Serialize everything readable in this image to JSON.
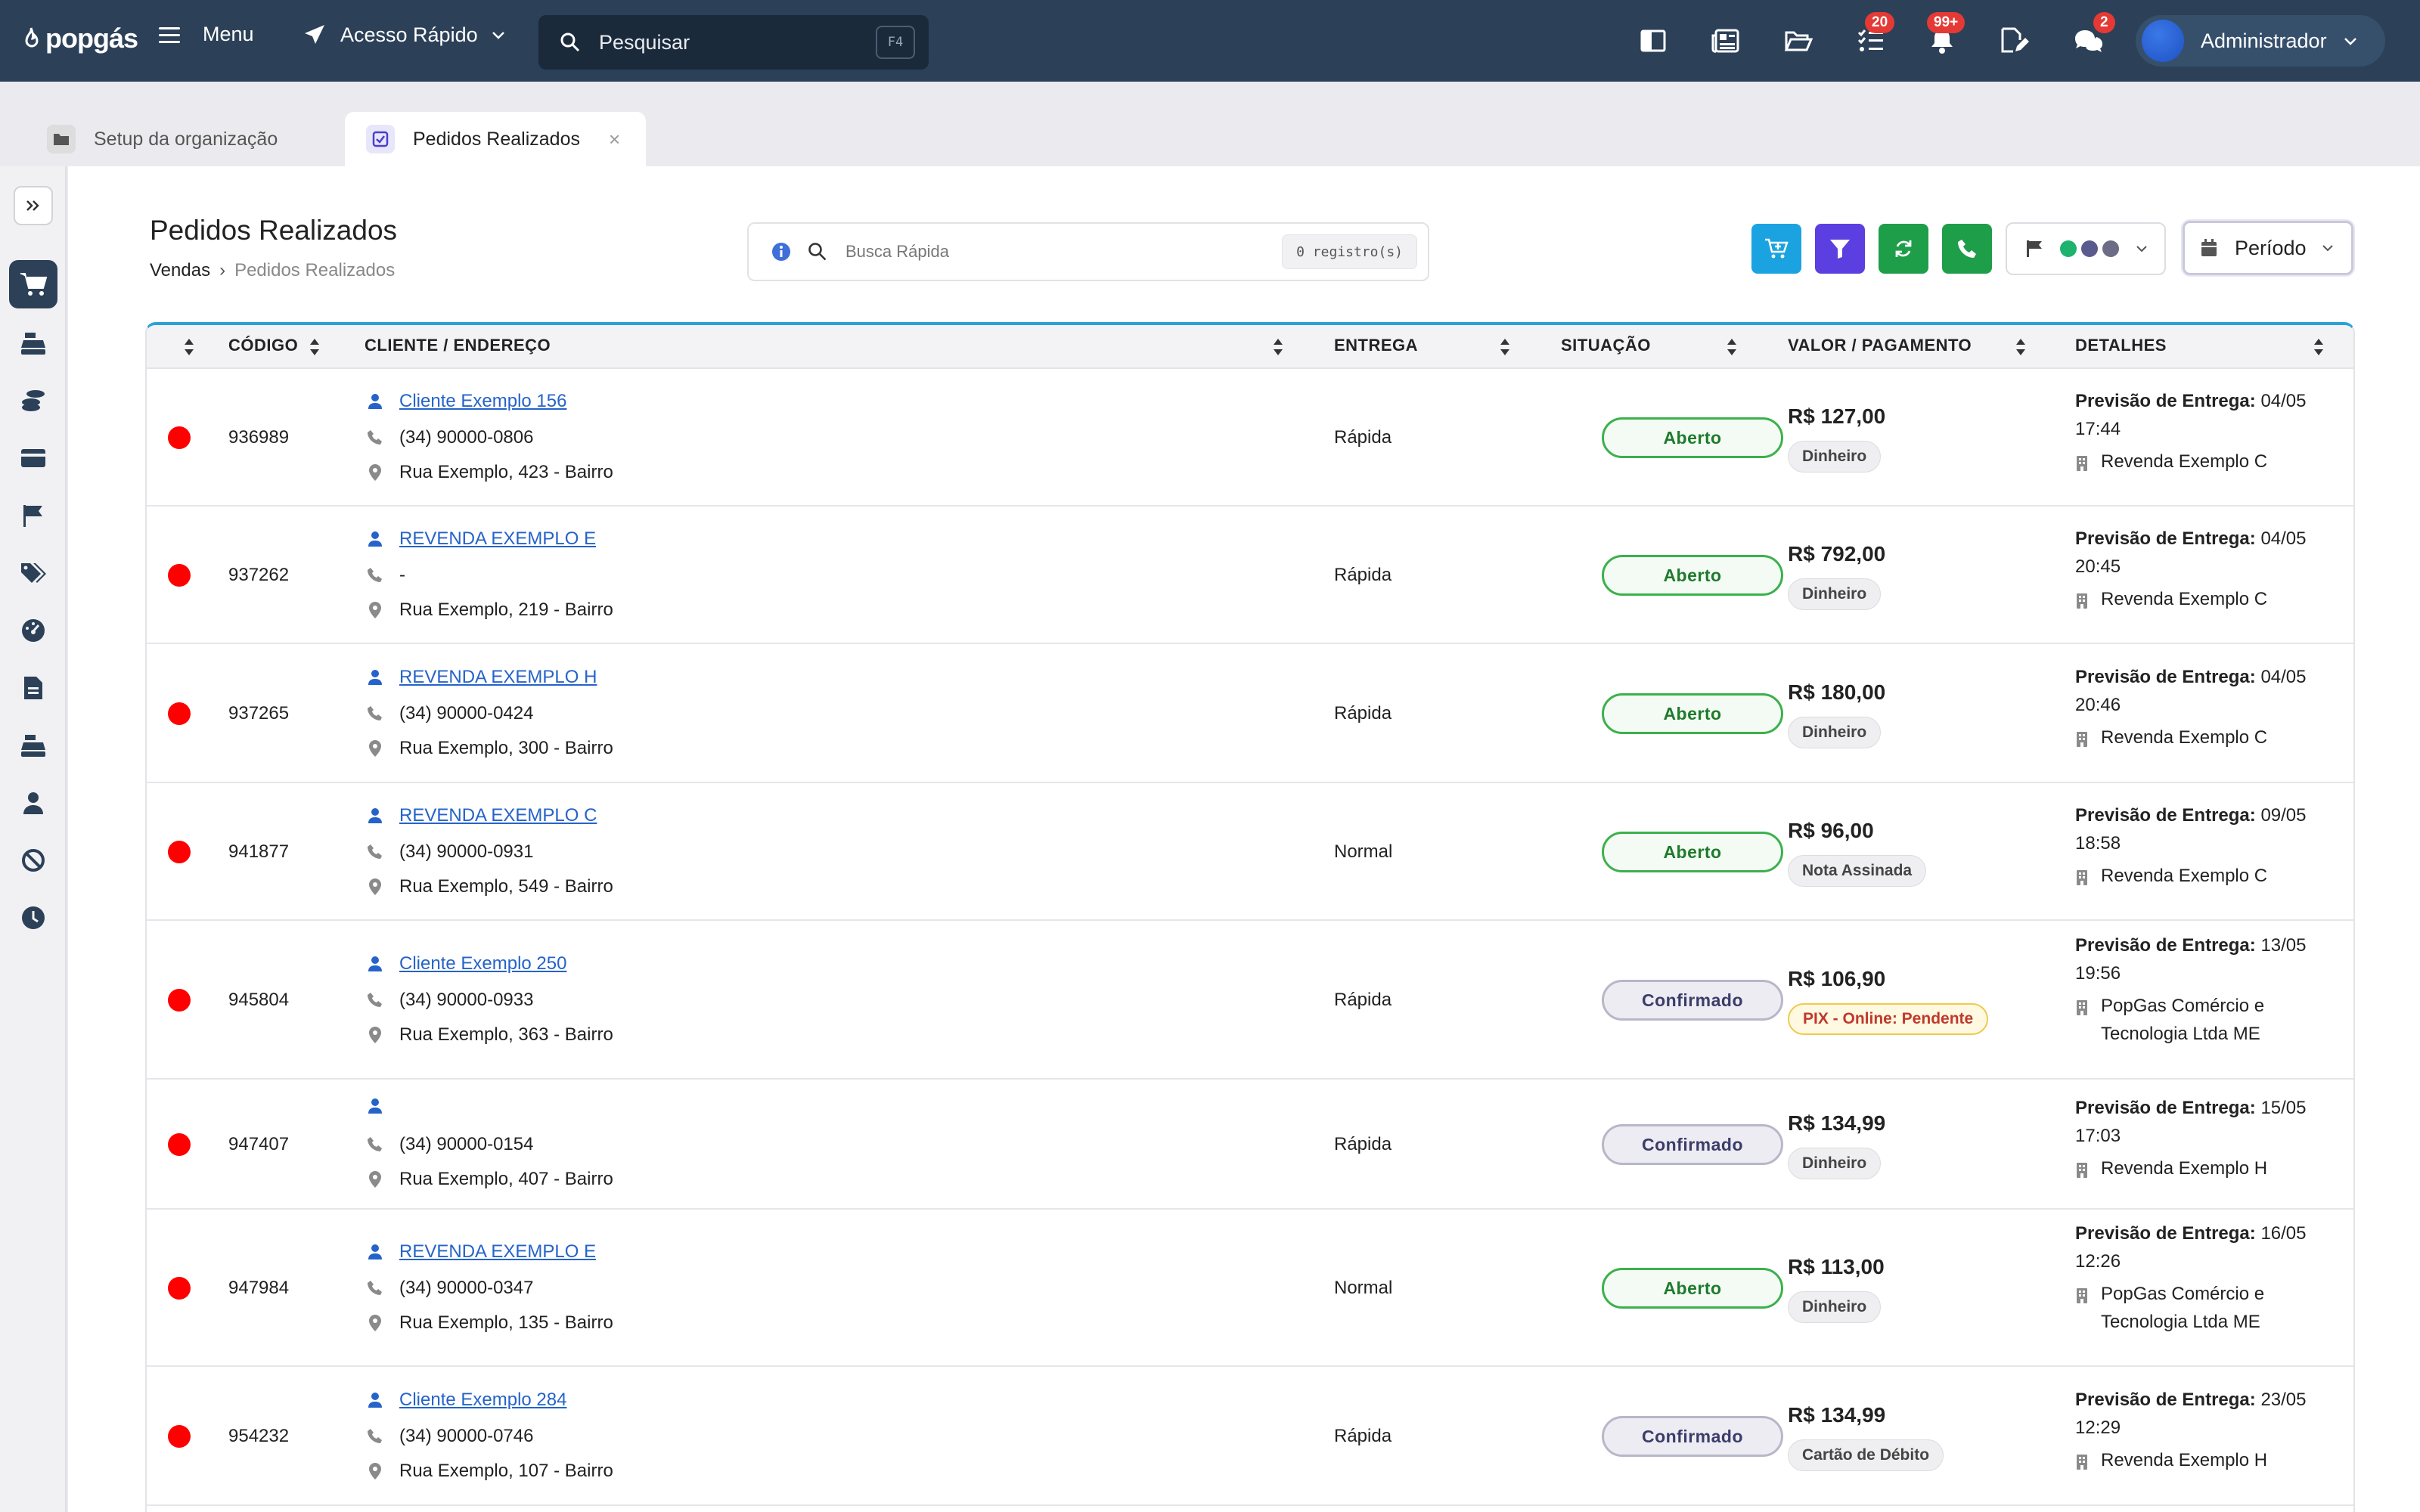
{
  "topbar": {
    "logo": "popgás",
    "menu_label": "Menu",
    "quick_access_label": "Acesso Rápido",
    "search_placeholder": "Pesquisar",
    "search_shortcut": "F4",
    "tasks_badge": "20",
    "notifications_badge": "99+",
    "chat_badge": "2",
    "user_name": "Administrador"
  },
  "tabs": [
    {
      "label": "Setup da organização",
      "active": false
    },
    {
      "label": "Pedidos Realizados",
      "active": true
    }
  ],
  "page": {
    "title": "Pedidos Realizados",
    "breadcrumb": [
      "Vendas",
      "Pedidos Realizados"
    ],
    "quick_search_placeholder": "Busca Rápida",
    "record_count": "0 registro(s)",
    "period_label": "Período"
  },
  "colors": {
    "topbar": "#2c4058",
    "cart_button": "#1aa3e0",
    "filter_button": "#5b3fe0",
    "refresh_button": "#1e9e49",
    "phone_button": "#1e9e49",
    "flag_dots": [
      "#1db26e",
      "#5a5a8e",
      "#6c6c86"
    ],
    "status_dot": "#ff0000"
  },
  "table": {
    "headers": {
      "code": "CÓDIGO",
      "client": "CLIENTE / ENDEREÇO",
      "delivery": "ENTREGA",
      "status": "SITUAÇÃO",
      "value": "VALOR / PAGAMENTO",
      "details": "DETALHES"
    },
    "rows": [
      {
        "code": "936989",
        "client": "Cliente Exemplo 156",
        "phone": "(34) 90000-0806",
        "address": "Rua Exemplo, 423 - Bairro",
        "delivery": "Rápida",
        "status": "Aberto",
        "value": "R$ 127,00",
        "payment": "Dinheiro",
        "forecast_label": "Previsão de Entrega:",
        "forecast_date": "04/05",
        "forecast_time": "17:44",
        "reseller": "Revenda Exemplo C"
      },
      {
        "code": "937262",
        "client": "REVENDA EXEMPLO E",
        "phone": "-",
        "address": "Rua Exemplo, 219 - Bairro",
        "delivery": "Rápida",
        "status": "Aberto",
        "value": "R$ 792,00",
        "payment": "Dinheiro",
        "forecast_label": "Previsão de Entrega:",
        "forecast_date": "04/05",
        "forecast_time": "20:45",
        "reseller": "Revenda Exemplo C"
      },
      {
        "code": "937265",
        "client": "REVENDA EXEMPLO H",
        "phone": "(34) 90000-0424",
        "address": "Rua Exemplo, 300 - Bairro",
        "delivery": "Rápida",
        "status": "Aberto",
        "value": "R$ 180,00",
        "payment": "Dinheiro",
        "forecast_label": "Previsão de Entrega:",
        "forecast_date": "04/05",
        "forecast_time": "20:46",
        "reseller": "Revenda Exemplo C"
      },
      {
        "code": "941877",
        "client": "REVENDA EXEMPLO C",
        "phone": "(34) 90000-0931",
        "address": "Rua Exemplo, 549 - Bairro",
        "delivery": "Normal",
        "status": "Aberto",
        "value": "R$ 96,00",
        "payment": "Nota Assinada",
        "forecast_label": "Previsão de Entrega:",
        "forecast_date": "09/05",
        "forecast_time": "18:58",
        "reseller": "Revenda Exemplo C"
      },
      {
        "code": "945804",
        "client": "Cliente Exemplo 250",
        "phone": "(34) 90000-0933",
        "address": "Rua Exemplo, 363 - Bairro",
        "delivery": "Rápida",
        "status": "Confirmado",
        "value": "R$ 106,90",
        "payment": "PIX - Online: Pendente",
        "forecast_label": "Previsão de Entrega:",
        "forecast_date": "13/05",
        "forecast_time": "19:56",
        "reseller": "PopGas Comércio e Tecnologia Ltda ME"
      },
      {
        "code": "947407",
        "client": "",
        "phone": "(34) 90000-0154",
        "address": "Rua Exemplo, 407 - Bairro",
        "delivery": "Rápida",
        "status": "Confirmado",
        "value": "R$ 134,99",
        "payment": "Dinheiro",
        "forecast_label": "Previsão de Entrega:",
        "forecast_date": "15/05",
        "forecast_time": "17:03",
        "reseller": "Revenda Exemplo H"
      },
      {
        "code": "947984",
        "client": "REVENDA EXEMPLO E",
        "phone": "(34) 90000-0347",
        "address": "Rua Exemplo, 135 - Bairro",
        "delivery": "Normal",
        "status": "Aberto",
        "value": "R$ 113,00",
        "payment": "Dinheiro",
        "forecast_label": "Previsão de Entrega:",
        "forecast_date": "16/05",
        "forecast_time": "12:26",
        "reseller": "PopGas Comércio e Tecnologia Ltda ME"
      },
      {
        "code": "954232",
        "client": "Cliente Exemplo 284",
        "phone": "(34) 90000-0746",
        "address": "Rua Exemplo, 107 - Bairro",
        "delivery": "Rápida",
        "status": "Confirmado",
        "value": "R$ 134,99",
        "payment": "Cartão de Débito",
        "forecast_label": "Previsão de Entrega:",
        "forecast_date": "23/05",
        "forecast_time": "12:29",
        "reseller": "Revenda Exemplo H"
      }
    ]
  }
}
